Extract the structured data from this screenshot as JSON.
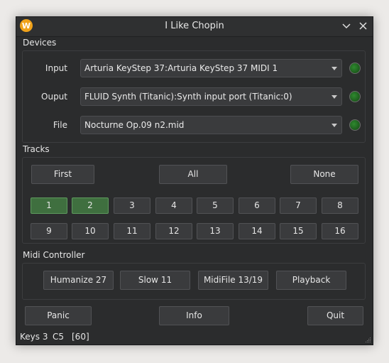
{
  "window": {
    "title": "I Like Chopin",
    "logo_letter": "W"
  },
  "devices": {
    "label": "Devices",
    "rows": [
      {
        "label": "Input",
        "value": "Arturia KeyStep 37:Arturia KeyStep 37 MIDI 1"
      },
      {
        "label": "Ouput",
        "value": "FLUID Synth (Titanic):Synth input port (Titanic:0)"
      },
      {
        "label": "File",
        "value": "Nocturne Op.09 n2.mid"
      }
    ],
    "led_color": "#2f8a2f"
  },
  "tracks": {
    "label": "Tracks",
    "first_label": "First",
    "all_label": "All",
    "none_label": "None",
    "items": [
      "1",
      "2",
      "3",
      "4",
      "5",
      "6",
      "7",
      "8",
      "9",
      "10",
      "11",
      "12",
      "13",
      "14",
      "15",
      "16"
    ],
    "active": [
      "1",
      "2"
    ],
    "active_color": "#3f6f3f"
  },
  "midi_controller": {
    "label": "Midi Controller",
    "humanize_label": "Humanize 27",
    "slow_label": "Slow 11",
    "midifile_label": "MidiFile 13/19",
    "playback_label": "Playback"
  },
  "actions": {
    "panic_label": "Panic",
    "info_label": "Info",
    "quit_label": "Quit"
  },
  "status": {
    "keys": "Keys 3",
    "note": "C5",
    "velocity": "[60]"
  }
}
